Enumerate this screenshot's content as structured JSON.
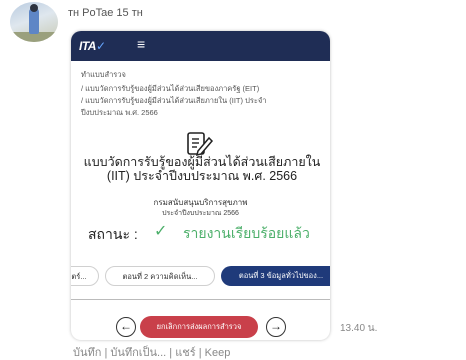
{
  "sender": "тн PoTae 15 тн",
  "card": {
    "logo_main": "ITA",
    "logo_mark": "✓",
    "menu_icon": "hamburger-icon",
    "breadcrumbs": [
      "ทำแบบสำรวจ",
      "/ แบบวัดการรับรู้ของผู้มีส่วนได้ส่วนเสียของภาครัฐ (EIT)",
      "/ แบบวัดการรับรู้ของผู้มีส่วนได้ส่วนเสียภายใน (IIT) ประจำ",
      "ปีงบประมาณ พ.ศ. 2566"
    ],
    "title": "แบบวัดการรับรู้ของผู้มีส่วนได้ส่วนเสียภายใน (IIT) ประจำปีงบประมาณ พ.ศ. 2566",
    "agency": "กรมสนับสนุนบริการสุขภาพ",
    "fiscal_year": "ประจำปีงบประมาณ 2566",
    "status_label": "สถานะ :",
    "status_check": "✓",
    "status_value": "รายงานเรียบร้อยแล้ว",
    "tabs": [
      "ตร์...",
      "ตอนที่ 2 ความคิดเห็น...",
      "ตอนที่ 3 ข้อมูลทั่วไปของ..."
    ],
    "prev_label": "←",
    "next_label": "→",
    "cancel_label": "ยกเลิกการส่งผลการสำรวจ"
  },
  "time": "13.40 น.",
  "actions": "บันทึก | บันทึกเป็น... | แชร์ | Keep",
  "colors": {
    "header": "#1f2d55",
    "status": "#4caf6a",
    "cancel": "#c9404a",
    "active_tab": "#1f3a7a"
  }
}
